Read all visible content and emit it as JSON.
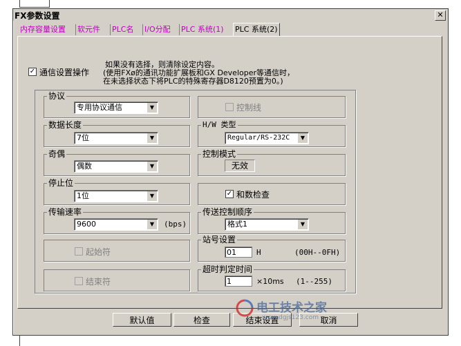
{
  "window": {
    "title": "FX参数设置",
    "close": "✕"
  },
  "tabs": [
    "内存容量设置",
    "软元件",
    "PLC名",
    "I/O分配",
    "PLC 系统(1)",
    "PLC 系统(2)"
  ],
  "comm": {
    "checkbox_mark": "✓",
    "label": "通信设置操作",
    "info1": "如果没有选择，则清除设定内容。",
    "info2": "(使用FXø的通讯功能扩展板和GX Developer等通信时，",
    "info3": "在未选择状态下将PLC的特殊寄存器D8120预置为0。)"
  },
  "protocol": {
    "label": "协议",
    "value": "专用协议通信"
  },
  "control_line": {
    "label": "控制线"
  },
  "data_length": {
    "label": "数据长度",
    "value": "7位"
  },
  "hw_type": {
    "label": "H/W 类型",
    "value": "Regular/RS-232C"
  },
  "parity": {
    "label": "奇偶",
    "value": "偶数"
  },
  "control_mode": {
    "label": "控制模式",
    "value": "无效"
  },
  "stop_bit": {
    "label": "停止位",
    "value": "1位"
  },
  "sum_check": {
    "mark": "✓",
    "label": "和数检查"
  },
  "baud": {
    "label": "传输速率",
    "value": "9600",
    "unit": "(bps)"
  },
  "transfer_control": {
    "label": "传送控制顺序",
    "value": "格式1"
  },
  "start_char": {
    "label": "起始符"
  },
  "station": {
    "label": "站号设置",
    "value": "01",
    "unit": "H",
    "range": "(00H--0FH)"
  },
  "end_char": {
    "label": "结束符"
  },
  "timeout": {
    "label": "超时判定时间",
    "value": "1",
    "unit": "×10ms",
    "range": "(1--255)"
  },
  "buttons": {
    "default": "默认值",
    "check": "检查",
    "finish": "结束设置",
    "cancel": "取消"
  },
  "watermark": {
    "name": "电工技术之家",
    "url": "www.dgjs123.com"
  },
  "arrow": "▼"
}
